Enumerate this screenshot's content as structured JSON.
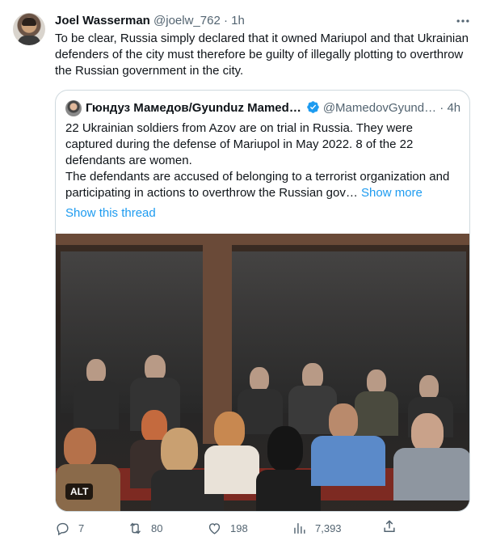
{
  "tweet": {
    "author_name": "Joel Wasserman",
    "handle": "@joelw_762",
    "dot": "·",
    "time": "1h",
    "text": "To be clear, Russia simply declared that it owned Mariupol and that Ukrainian defenders of the city must therefore be guilty of illegally plotting to overthrow the Russian government in the city."
  },
  "quote": {
    "author_name": "Гюндуз Мамедов/Gyunduz Mamed…",
    "handle": "@MamedovGyund…",
    "dot": "·",
    "time": "4h",
    "text_p1": "22 Ukrainian soldiers from Azov are on trial in Russia. They were captured during the defense of Mariupol in May 2022. 8 of the 22 defendants are women.",
    "text_p2": "The defendants are accused of belonging to a terrorist organization and participating in actions to overthrow the Russian gov…",
    "show_more": "Show more",
    "show_thread": "Show this thread",
    "alt_label": "ALT"
  },
  "actions": {
    "replies": "7",
    "retweets": "80",
    "likes": "198",
    "views": "7,393"
  },
  "icons": [
    "more-icon",
    "verified-icon",
    "reply-icon",
    "retweet-icon",
    "like-icon",
    "views-icon",
    "share-icon"
  ],
  "colors": {
    "accent": "#1d9bf0",
    "secondary_text": "#536471",
    "border": "#cfd9de"
  }
}
